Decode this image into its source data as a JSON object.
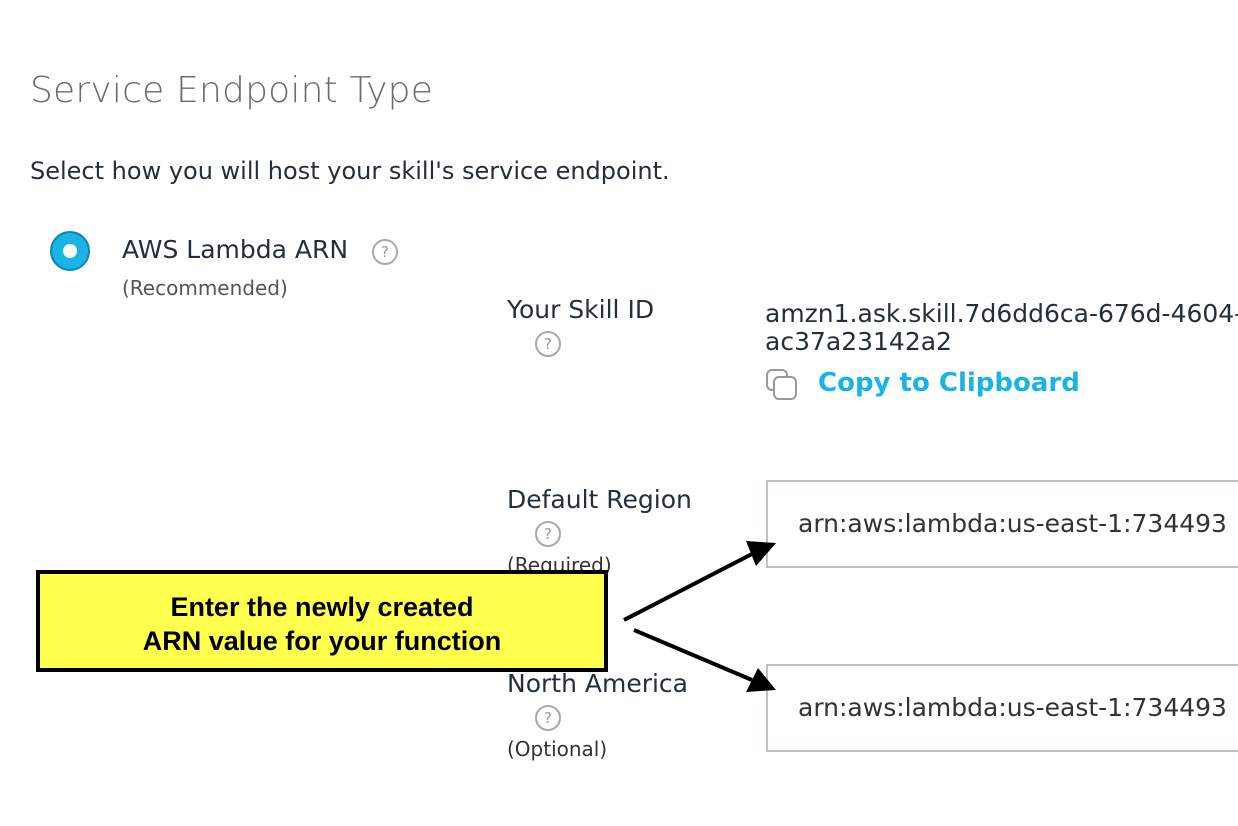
{
  "section": {
    "title": "Service Endpoint Type",
    "subtitle": "Select how you will host your skill's service endpoint."
  },
  "endpoint_option": {
    "label": "AWS Lambda ARN",
    "note": "(Recommended)",
    "selected": true,
    "help_icon": "question-circle-icon"
  },
  "skill_id": {
    "label": "Your Skill ID",
    "value_line1": "amzn1.ask.skill.7d6dd6ca-676d-4604-",
    "value_line2": "ac37a23142a2",
    "copy_label": "Copy to Clipboard",
    "copy_icon": "copy-icon"
  },
  "default_region": {
    "label": "Default Region",
    "note": "(Required)",
    "value": "arn:aws:lambda:us-east-1:734493"
  },
  "north_america": {
    "label": "North America",
    "note": "(Optional)",
    "value": "arn:aws:lambda:us-east-1:734493"
  },
  "help_glyph": "?",
  "callout": {
    "line1": "Enter the newly created",
    "line2": "ARN value for your function"
  },
  "colors": {
    "accent": "#1ab3e6",
    "callout_bg": "#ffff4d",
    "input_border": "#b9c3c4"
  }
}
